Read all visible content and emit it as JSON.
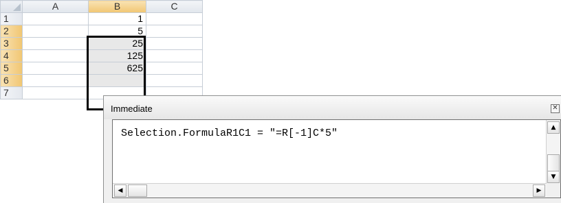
{
  "sheet": {
    "columns": [
      "A",
      "B",
      "C"
    ],
    "rows": [
      {
        "header": "1",
        "a": "",
        "b": "1",
        "c": ""
      },
      {
        "header": "2",
        "a": "",
        "b": "5",
        "c": ""
      },
      {
        "header": "3",
        "a": "",
        "b": "25",
        "c": ""
      },
      {
        "header": "4",
        "a": "",
        "b": "125",
        "c": ""
      },
      {
        "header": "5",
        "a": "",
        "b": "625",
        "c": ""
      },
      {
        "header": "6",
        "a": "",
        "b": "",
        "c": ""
      },
      {
        "header": "7",
        "a": "",
        "b": "",
        "c": ""
      }
    ],
    "selected_range": "B2:B6"
  },
  "immediate": {
    "title": "Immediate",
    "code": "Selection.FormulaR1C1 = \"=R[-1]C*5\"",
    "close_glyph": "✕"
  },
  "colors": {
    "selection_fill": "#e8e8e8",
    "header_highlight": "#f1c672",
    "gridline": "#c6cdd6"
  }
}
